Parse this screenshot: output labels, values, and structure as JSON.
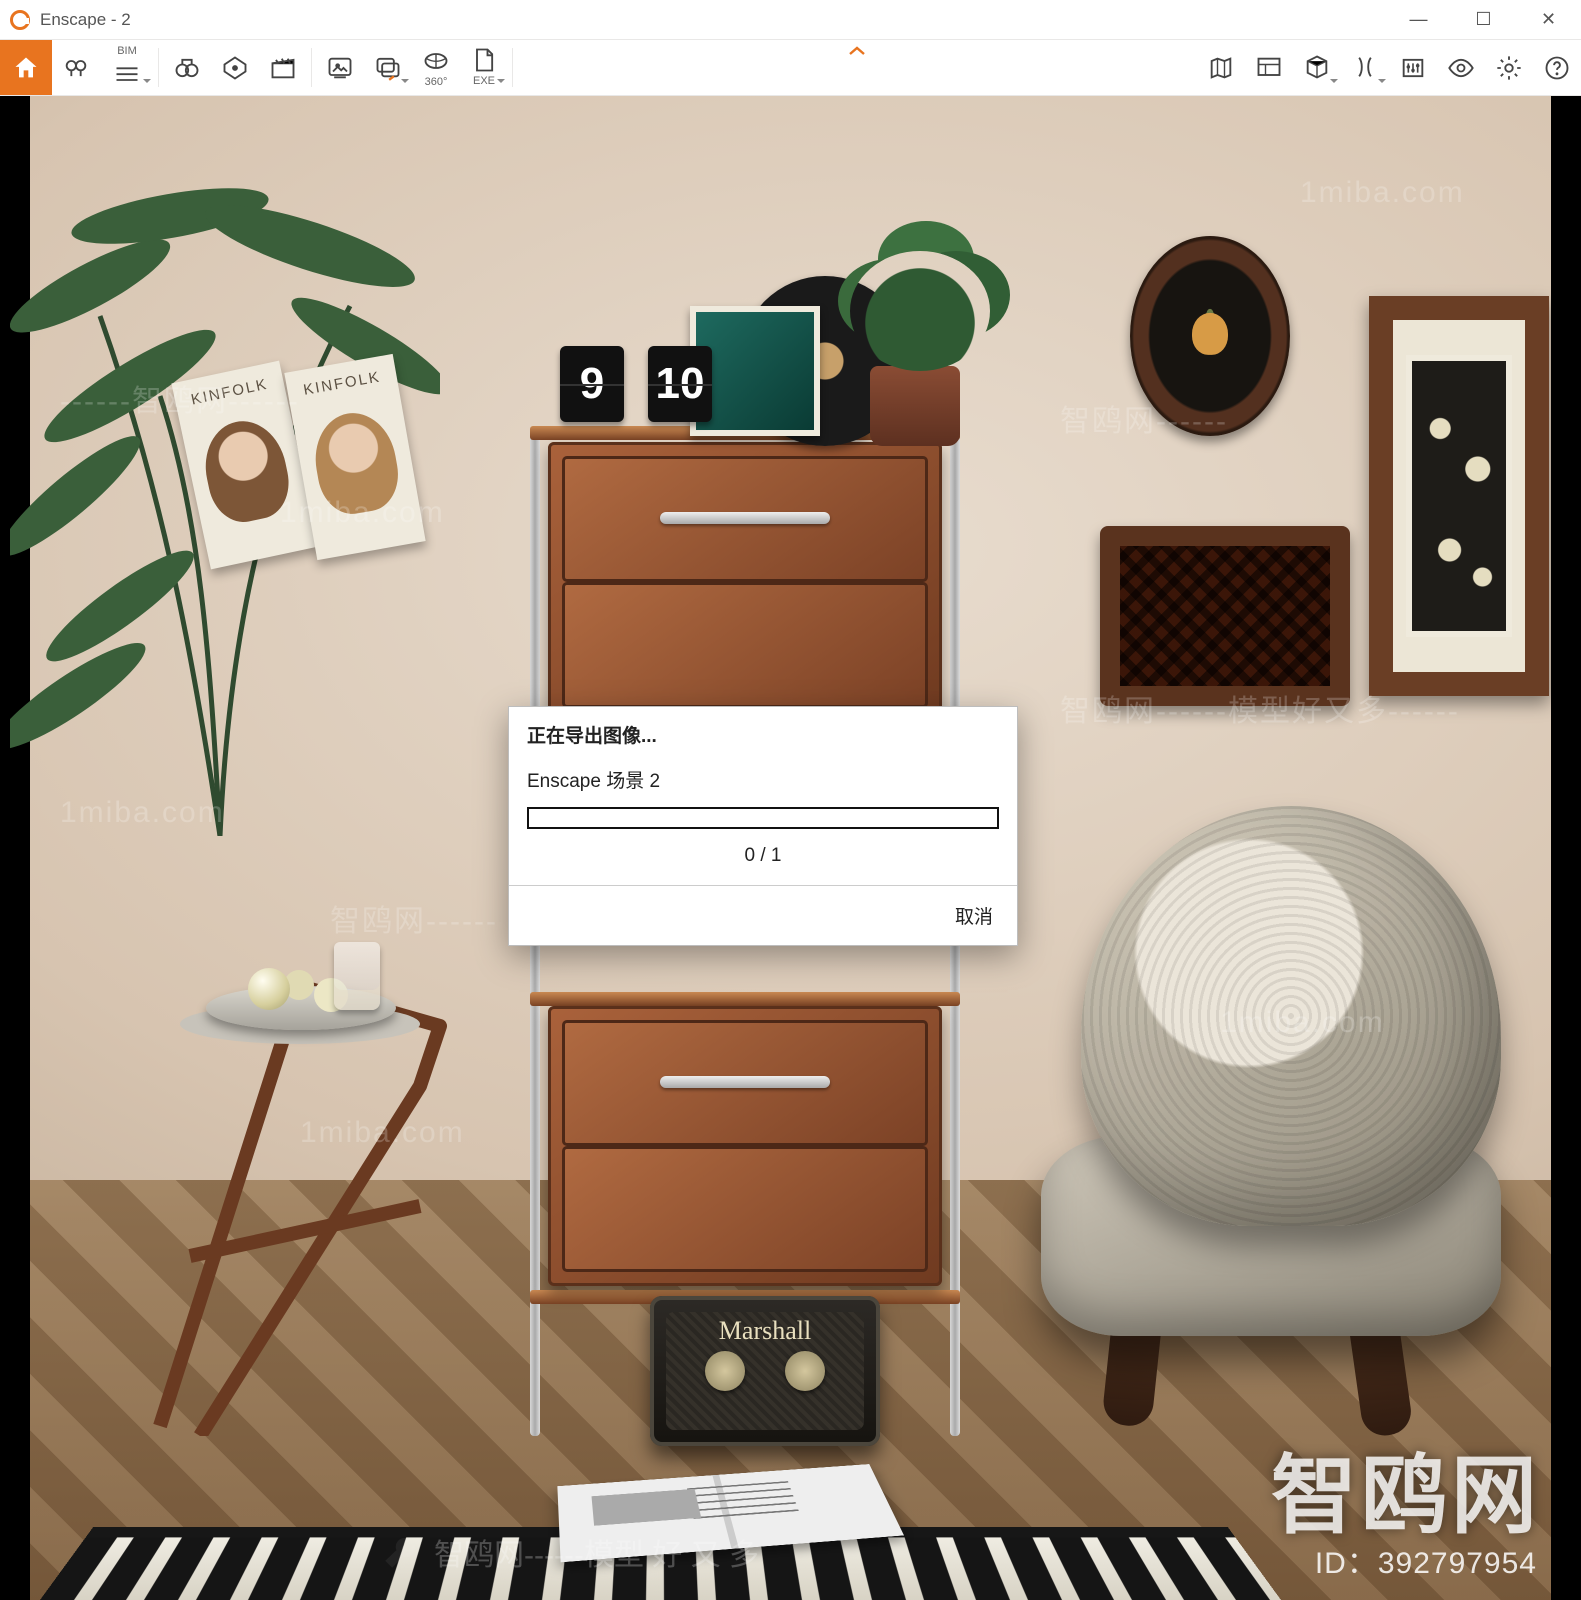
{
  "window": {
    "title": "Enscape - 2",
    "controls": {
      "minimize": "—",
      "maximize": "☐",
      "close": "✕"
    }
  },
  "toolbar": {
    "bim_label": "BIM",
    "pano_label": "360°",
    "exe_label": "EXE"
  },
  "scene": {
    "clock": {
      "left": "9",
      "right": "10"
    },
    "book_title": "KINFOLK",
    "speaker_brand": "Marshall"
  },
  "dialog": {
    "title": "正在导出图像...",
    "scene": "Enscape 场景 2",
    "progress_text": "0 / 1",
    "cancel": "取消"
  },
  "watermark": {
    "site": "1miba.com",
    "text": "智鸥网------",
    "text2": "------智鸥网------",
    "slogan": "智鸥网------模型好又多------",
    "big": "智鸥网",
    "id": "ID：392797954",
    "bottom_overlay": "智鸥网------模型 好 又 多"
  }
}
